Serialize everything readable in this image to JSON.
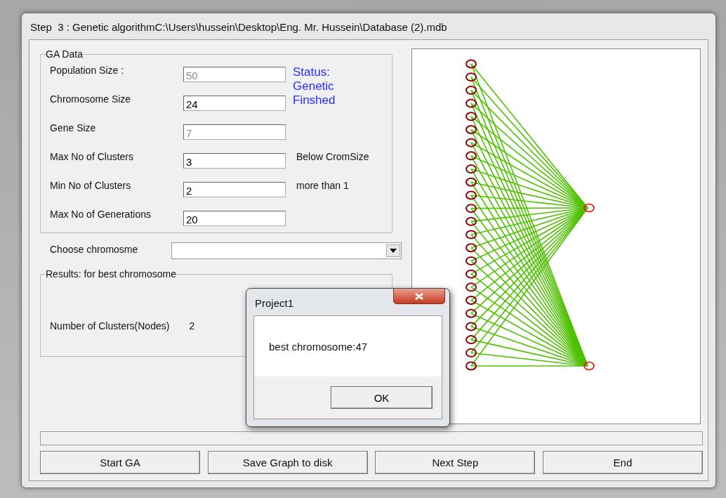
{
  "window": {
    "title": "Step  3 : Genetic algorithmC:\\Users\\hussein\\Desktop\\Eng. Mr. Hussein\\Database (2).mdb"
  },
  "ga_data": {
    "title": "GA Data",
    "status": "Status: Genetic Finshed",
    "fields": [
      {
        "label": "Population Size :",
        "value": "50",
        "disabled": true
      },
      {
        "label": "Chromosome Size",
        "value": "24",
        "disabled": false
      },
      {
        "label": "Gene Size",
        "value": "7",
        "disabled": true
      },
      {
        "label": "Max No of Clusters",
        "value": "3",
        "disabled": false,
        "note": "Below CromSize"
      },
      {
        "label": "Min No of Clusters",
        "value": "2",
        "disabled": false,
        "note": "more than 1"
      },
      {
        "label": "Max No of Generations",
        "value": "20",
        "disabled": false
      }
    ]
  },
  "chooser": {
    "label": "Choose chromosme"
  },
  "results": {
    "title": "Results: for best chromosome",
    "label": "Number of Clusters(Nodes)",
    "value": "2"
  },
  "buttons": [
    "Start GA",
    "Save Graph to disk",
    "Next Step",
    "End"
  ],
  "dialog": {
    "title": "Project1",
    "message": "best chromosome:47",
    "button": "OK"
  }
}
